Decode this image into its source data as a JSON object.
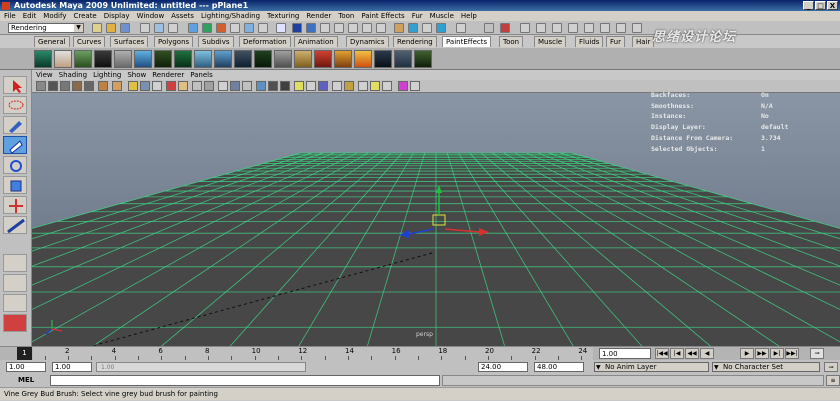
{
  "window": {
    "title": "Autodesk Maya 2009 Unlimited: untitled    ---    pPlane1",
    "buttons": [
      "_",
      "□",
      "X"
    ]
  },
  "menubar": [
    "File",
    "Edit",
    "Modify",
    "Create",
    "Display",
    "Window",
    "Assets",
    "Lighting/Shading",
    "Texturing",
    "Render",
    "Toon",
    "Paint Effects",
    "Fur",
    "Muscle",
    "Help"
  ],
  "status_line": {
    "mode": "Rendering"
  },
  "shelf": {
    "tabs": [
      "General",
      "Curves",
      "Surfaces",
      "Polygons",
      "Subdivs",
      "Deformation",
      "Animation",
      "Dynamics",
      "Rendering",
      "PaintEffects",
      "Toon",
      "Muscle",
      "Fluids",
      "Fur",
      "Hair"
    ],
    "active_tab": "PaintEffects"
  },
  "watermark": "思绪设计论坛",
  "panel": {
    "menus": [
      "View",
      "Shading",
      "Lighting",
      "Show",
      "Renderer",
      "Panels"
    ]
  },
  "hud": [
    {
      "label": "Backfaces:",
      "value": "On"
    },
    {
      "label": "Smoothness:",
      "value": "N/A"
    },
    {
      "label": "Instance:",
      "value": "No"
    },
    {
      "label": "Display Layer:",
      "value": "default"
    },
    {
      "label": "Distance From Camera:",
      "value": "3.734"
    },
    {
      "label": "Selected Objects:",
      "value": "1"
    }
  ],
  "viewport": {
    "persp_label": "persp"
  },
  "colors": {
    "viewport_top": "#8a96a6",
    "viewport_bottom": "#5d6878",
    "plane": "#474747",
    "grid": "#3edc8a",
    "axis_x": "#d83030",
    "axis_y": "#20c040",
    "axis_z": "#2040d0"
  },
  "timeline": {
    "ticks": [
      "2",
      "4",
      "6",
      "8",
      "10",
      "12",
      "14",
      "16",
      "18",
      "20",
      "22",
      "24"
    ],
    "current_frame": "1",
    "current_time": "1.00"
  },
  "range": {
    "start": "1.00",
    "inner_start": "1.00",
    "range_slider": "1.00",
    "end": "24.00",
    "outer_end": "48.00",
    "anim_layer": "No Anim Layer",
    "character_set": "No Character Set"
  },
  "command_line": {
    "label": "MEL"
  },
  "help_line": "Vine Grey Bud Brush: Select vine grey bud brush for painting"
}
